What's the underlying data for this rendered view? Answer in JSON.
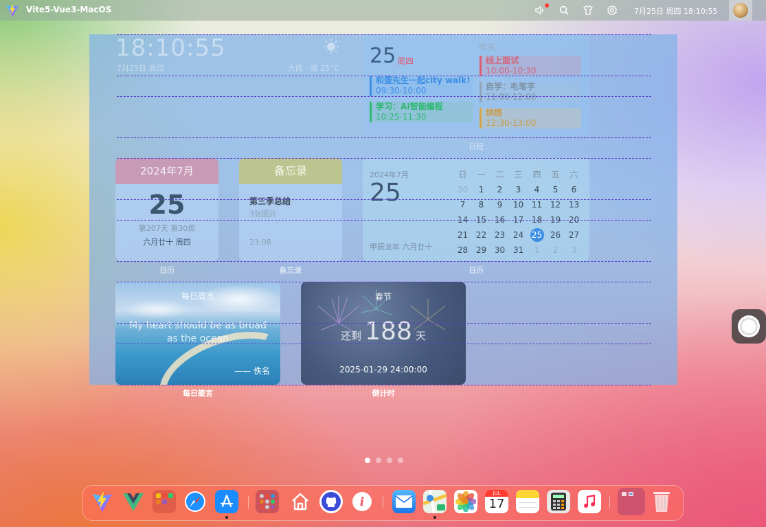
{
  "topbar": {
    "app_title": "Vite5-Vue3-MacOS",
    "clock": "7月25日 周四 18:10:55",
    "icons": [
      "volume-icon",
      "search-icon",
      "shirt-icon",
      "settings-icon"
    ],
    "notification_color": "#ff3b30"
  },
  "clock_widget": {
    "time": "18:10:55",
    "date": "7月25日 周四",
    "weather": "大雨 · 晴 25°C",
    "icon": "sun-icon"
  },
  "schedule_widget": {
    "day": "25",
    "weekday": "周四",
    "today_events": [
      {
        "title": "和蛋先生一起city walk!",
        "time": "09:30-10:00",
        "color": "#3d8fe6"
      },
      {
        "title": "学习：AI智能编程",
        "time": "10:25-11:30",
        "color": "#2fb872"
      }
    ],
    "yesterday_label": "昨天",
    "yesterday_events": [
      {
        "title": "线上面试",
        "time": "10:00-10:30",
        "color": "#e05b74"
      },
      {
        "title": "自学：毛笔字",
        "time": "11:00-12:00",
        "color": "#8ea3b6"
      },
      {
        "title": "烘焙",
        "time": "12:30-13:00",
        "color": "#d9a441"
      }
    ],
    "label": "日程"
  },
  "calendar_widget": {
    "month": "2024年7月",
    "day": "25",
    "info": "第207天 第30周",
    "lunar": "六月廿十 周四",
    "label": "日历"
  },
  "memo_widget": {
    "title": "备忘录",
    "note_title": "第三季总结",
    "note_sub": "3张图片",
    "time": "23:08",
    "label": "备忘录"
  },
  "month_calendar_widget": {
    "month": "2024年7月",
    "day": "25",
    "lunar": "甲辰龙年 六月廿十",
    "weekdays": [
      "日",
      "一",
      "二",
      "三",
      "四",
      "五",
      "六"
    ],
    "days": [
      "30",
      "1",
      "2",
      "3",
      "4",
      "5",
      "6",
      "7",
      "8",
      "9",
      "10",
      "11",
      "12",
      "13",
      "14",
      "15",
      "16",
      "17",
      "18",
      "19",
      "20",
      "21",
      "22",
      "23",
      "24",
      "25",
      "26",
      "27",
      "28",
      "29",
      "30",
      "31",
      "1",
      "2",
      "3"
    ],
    "today": "25",
    "label": "日历"
  },
  "quote_widget": {
    "title": "每日箴言",
    "text": "My heart should be as broad as the ocean",
    "author": "—— 佚名",
    "label": "每日箴言"
  },
  "countdown_widget": {
    "title": "春节",
    "prefix": "还剩",
    "days": "188",
    "unit": "天",
    "date": "2025-01-29 24:00:00",
    "label": "倒计时"
  },
  "pagination": {
    "pages": 4,
    "current": 1
  },
  "dock": {
    "apps": [
      "vite-icon",
      "vue-icon",
      "launchpad-folder-icon",
      "safari-icon",
      "app-store-icon",
      "apps-folder-icon",
      "home-icon",
      "github-icon",
      "info-icon",
      "mail-icon",
      "maps-icon",
      "photos-icon",
      "calendar-icon",
      "notes-icon",
      "calculator-icon",
      "music-icon",
      "folder-icon",
      "trash-icon"
    ],
    "calendar_month": "JUL",
    "calendar_day": "17"
  }
}
